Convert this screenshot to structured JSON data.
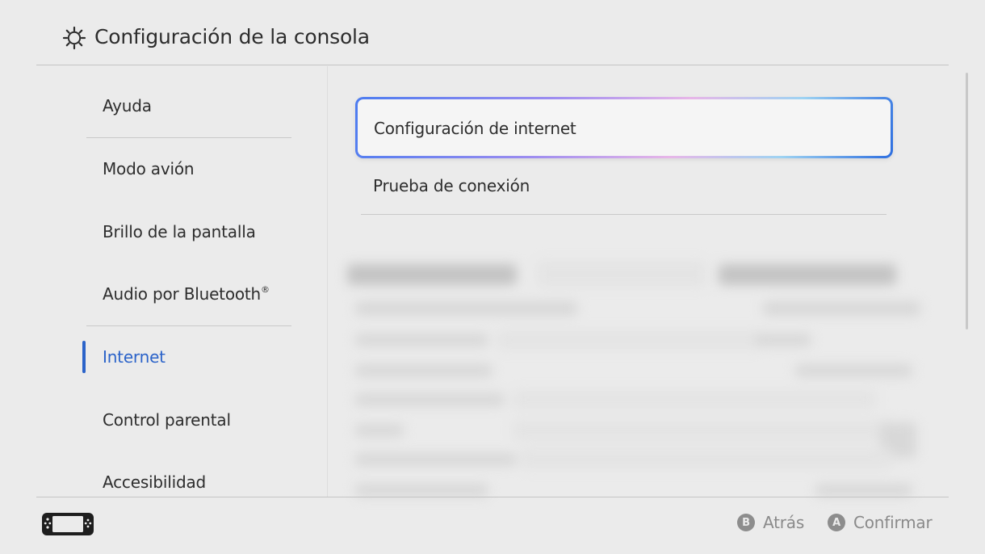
{
  "header": {
    "title": "Configuración de la consola",
    "icon": "gear-icon"
  },
  "sidebar": {
    "items": [
      {
        "label": "Ayuda"
      },
      {
        "label": "Modo avión"
      },
      {
        "label": "Brillo de la pantalla"
      },
      {
        "label": "Audio por Bluetooth",
        "sup": "®"
      },
      {
        "label": "Internet",
        "active": true
      },
      {
        "label": "Control parental"
      },
      {
        "label": "Accesibilidad"
      }
    ]
  },
  "main": {
    "items": [
      {
        "label": "Configuración de internet",
        "selected": true
      },
      {
        "label": "Prueba de conexión"
      }
    ]
  },
  "footer": {
    "icon": "console-icon",
    "back": {
      "button": "B",
      "label": "Atrás"
    },
    "confirm": {
      "button": "A",
      "label": "Confirmar"
    }
  },
  "colors": {
    "accent": "#2b63c9",
    "background": "#ebebeb",
    "hint": "#8a8a8a"
  }
}
